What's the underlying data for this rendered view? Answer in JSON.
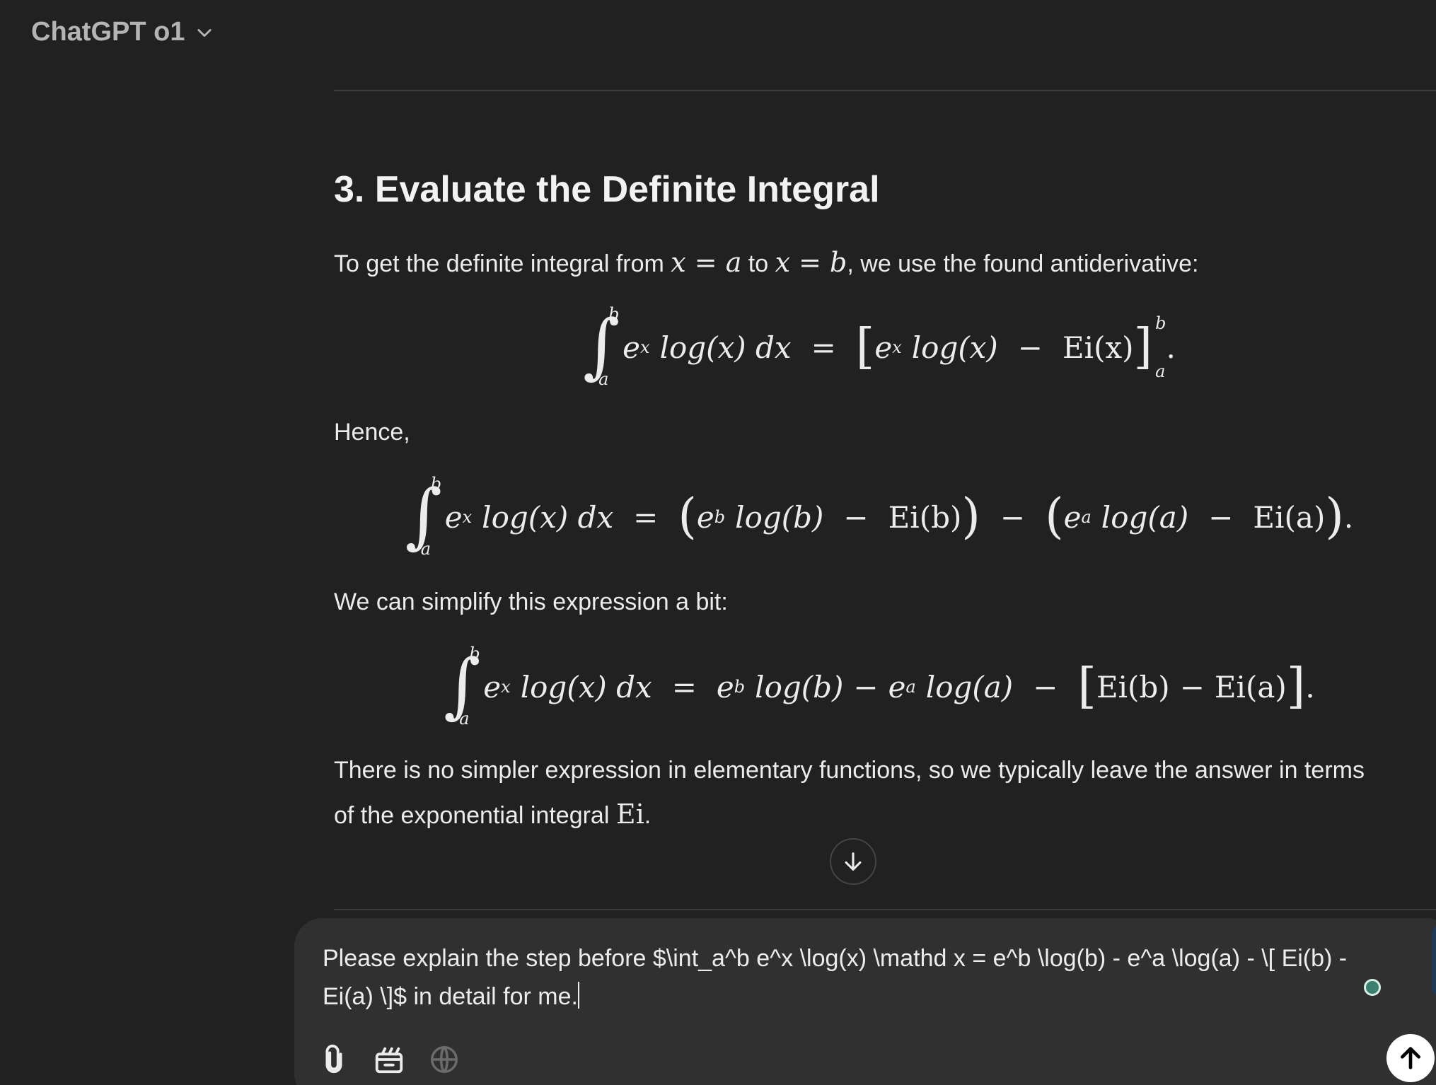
{
  "header": {
    "model_name": "ChatGPT o1"
  },
  "icons": {
    "model_chevron": "chevron-down-icon",
    "scroll": "arrow-down-icon",
    "attach": "paperclip-icon",
    "tools": "briefcase-icon",
    "web": "globe-icon",
    "send": "arrow-up-icon"
  },
  "message": {
    "section_title": "3. Evaluate the Definite Integral",
    "para1": {
      "text_a": "To get the definite integral from ",
      "math_a": "x = a",
      "text_b": " to ",
      "math_b": "x = b",
      "text_c": ", we use the found antiderivative:"
    },
    "eq1": {
      "upper": "b",
      "lower": "a",
      "lhs_base": "e",
      "lhs_exp": "x",
      "lhs_rest": "log(x) dx",
      "eq": "=",
      "br_open": "[",
      "rhs_base": "e",
      "rhs_exp": "x",
      "rhs_log": "log(x)",
      "minus": "−",
      "ei": "Ei(x)",
      "br_close": "]",
      "lim_hi": "b",
      "lim_lo": "a",
      "dot": "."
    },
    "para2": "Hence,",
    "eq2": {
      "upper": "b",
      "lower": "a",
      "lhs_base": "e",
      "lhs_exp": "x",
      "lhs_rest": "log(x) dx",
      "eq": "=",
      "g1_open": "(",
      "g1_base": "e",
      "g1_exp": "b",
      "g1_log": "log(b)",
      "g1_minus": "−",
      "g1_ei": "Ei(b)",
      "g1_close": ")",
      "minus": "−",
      "g2_open": "(",
      "g2_base": "e",
      "g2_exp": "a",
      "g2_log": "log(a)",
      "g2_minus": "−",
      "g2_ei": "Ei(a)",
      "g2_close": ")",
      "dot": "."
    },
    "para3": "We can simplify this expression a bit:",
    "eq3": {
      "upper": "b",
      "lower": "a",
      "lhs_base": "e",
      "lhs_exp": "x",
      "lhs_rest": "log(x) dx",
      "eq": "=",
      "t1_base": "e",
      "t1_exp": "b",
      "t1_log": "log(b)",
      "m1": "−",
      "t2_base": "e",
      "t2_exp": "a",
      "t2_log": "log(a)",
      "m2": "−",
      "br_open": "[",
      "ei_b": "Ei(b)",
      "m3": "−",
      "ei_a": "Ei(a)",
      "br_close": "]",
      "dot": "."
    },
    "para4": {
      "line1": "There is no simpler expression in elementary functions, so we typically leave the answer in terms",
      "line2_text": "of the exponential integral ",
      "line2_math": "Ei",
      "line2_end": "."
    }
  },
  "composer": {
    "value": "Please explain the step before $\\int_a^b e^x \\log(x) \\mathd x = e^b \\log(b) - e^a \\log(a) - \\[ Ei(b) - Ei(a) \\]$ in detail for me."
  }
}
